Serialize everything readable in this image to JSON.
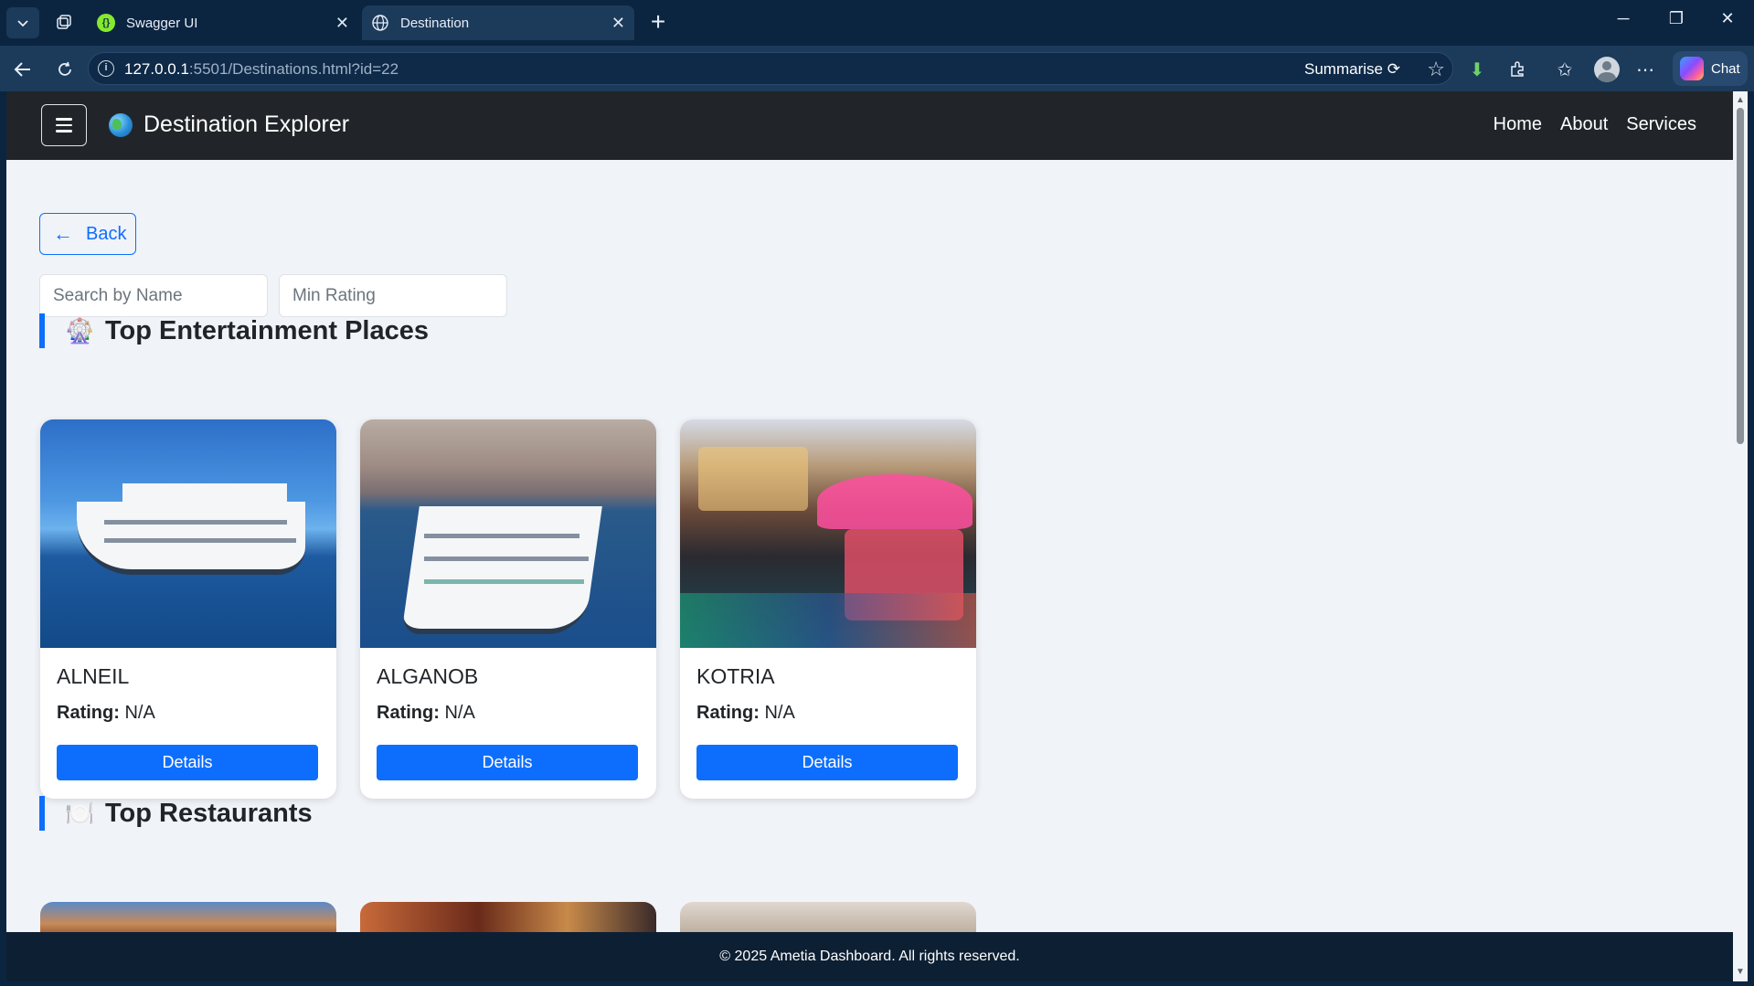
{
  "browser": {
    "tabs": [
      {
        "title": "Swagger UI",
        "active": false
      },
      {
        "title": "Destination",
        "active": true
      }
    ],
    "url_host": "127.0.0.1",
    "url_rest": ":5501/Destinations.html?id=22",
    "summarise_label": "Summarise",
    "chat_label": "Chat"
  },
  "navbar": {
    "brand": "Destination Explorer",
    "links": [
      "Home",
      "About",
      "Services"
    ]
  },
  "page": {
    "back_label": "Back",
    "search_placeholder": "Search by Name",
    "rating_placeholder": "Min Rating",
    "sections": [
      {
        "title": "Top Entertainment Places",
        "emoji": "🎡",
        "cards": [
          {
            "name": "ALNEIL",
            "rating_label": "Rating:",
            "rating_value": "N/A",
            "button": "Details"
          },
          {
            "name": "ALGANOB",
            "rating_label": "Rating:",
            "rating_value": "N/A",
            "button": "Details"
          },
          {
            "name": "KOTRIA",
            "rating_label": "Rating:",
            "rating_value": "N/A",
            "button": "Details"
          }
        ]
      },
      {
        "title": "Top Restaurants",
        "emoji": "🍽️"
      }
    ]
  },
  "footer": {
    "text": "© 2025 Ametia Dashboard. All rights reserved."
  },
  "colors": {
    "primary": "#0d6efd",
    "navbar": "#212529",
    "page_bg": "#f0f3f8",
    "browser_bg": "#0b2541"
  }
}
